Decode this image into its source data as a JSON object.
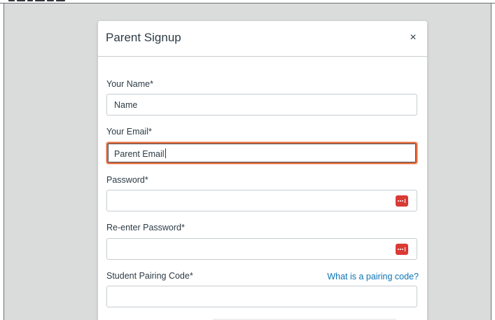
{
  "modal": {
    "title": "Parent Signup",
    "close_glyph": "×"
  },
  "fields": {
    "name": {
      "label": "Your Name*",
      "value": "Name"
    },
    "email": {
      "label": "Your Email*",
      "value": "Parent Email",
      "focused": true
    },
    "password": {
      "label": "Password*",
      "value": "",
      "icon": "password-manager-icon"
    },
    "reenter_password": {
      "label": "Re-enter Password*",
      "value": "",
      "icon": "password-manager-icon"
    },
    "pairing_code": {
      "label": "Student Pairing Code*",
      "value": "",
      "help_link": "What is a pairing code?"
    }
  },
  "colors": {
    "focus_ring": "#e66a3a",
    "link": "#0b74b5",
    "password_icon": "#d93a35",
    "backdrop": "#d9dcdb",
    "text": "#2d3b45"
  }
}
